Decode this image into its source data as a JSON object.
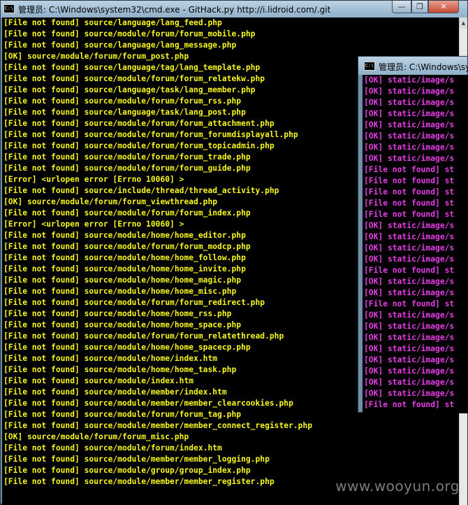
{
  "main_window": {
    "icon_label": "C:\\",
    "title": "管理员: C:\\Windows\\system32\\cmd.exe - GitHack.py  http://i.lidroid.com/.git",
    "controls": {
      "minimize": "—",
      "maximize": "❐",
      "close": "✕"
    },
    "lines": [
      "[File not found] source/language/lang_feed.php",
      "[File not found] source/module/forum/forum_mobile.php",
      "[File not found] source/language/lang_message.php",
      "[OK] source/module/forum/forum_post.php",
      "[File not found] source/language/tag/lang_template.php",
      "[File not found] source/module/forum/forum_relatekw.php",
      "[File not found] source/language/task/lang_member.php",
      "[File not found] source/module/forum/forum_rss.php",
      "[File not found] source/language/task/lang_post.php",
      "[File not found] source/module/forum/forum_attachment.php",
      "[File not found] source/module/forum/forum_forumdisplayall.php",
      "[File not found] source/module/forum/forum_topicadmin.php",
      "[File not found] source/module/forum/forum_trade.php",
      "[File not found] source/module/forum/forum_guide.php",
      "[Error] <urlopen error [Errno 10060] >",
      "[File not found] source/include/thread/thread_activity.php",
      "[OK] source/module/forum/forum_viewthread.php",
      "[File not found] source/module/forum/forum_index.php",
      "[Error] <urlopen error [Errno 10060] >",
      "[File not found] source/module/home/home_editor.php",
      "[File not found] source/module/forum/forum_modcp.php",
      "[File not found] source/module/home/home_follow.php",
      "[File not found] source/module/home/home_invite.php",
      "[File not found] source/module/home/home_magic.php",
      "[File not found] source/module/home/home_misc.php",
      "[File not found] source/module/forum/forum_redirect.php",
      "[File not found] source/module/home/home_rss.php",
      "[File not found] source/module/home/home_space.php",
      "[File not found] source/module/forum/forum_relatethread.php",
      "[File not found] source/module/home/home_spacecp.php",
      "[File not found] source/module/home/index.htm",
      "[File not found] source/module/home/home_task.php",
      "[File not found] source/module/index.htm",
      "[File not found] source/module/member/index.htm",
      "[File not found] source/module/member/member_clearcookies.php",
      "[File not found] source/module/forum/forum_tag.php",
      "[File not found] source/module/member/member_connect_register.php",
      "[OK] source/module/forum/forum_misc.php",
      "[File not found] source/module/forum/index.htm",
      "[File not found] source/module/member/member_logging.php",
      "[File not found] source/module/group/group_index.php",
      "[File not found] source/module/member/member_register.php"
    ]
  },
  "second_window": {
    "icon_label": "C:\\",
    "title": "管理员: C:\\Windows\\sys",
    "lines": [
      "[OK] static/image/s",
      "[OK] static/image/s",
      "[OK] static/image/s",
      "[OK] static/image/s",
      "[OK] static/image/s",
      "[OK] static/image/s",
      "[OK] static/image/s",
      "[OK] static/image/s",
      "[File not found] st",
      "[File not found] st",
      "[File not found] st",
      "[File not found] st",
      "[File not found] st",
      "[OK] static/image/s",
      "[OK] static/image/s",
      "[OK] static/image/s",
      "[OK] static/image/s",
      "[File not found] st",
      "[OK] static/image/s",
      "[OK] static/image/s",
      "[File not found] st",
      "[OK] static/image/s",
      "[OK] static/image/s",
      "[OK] static/image/s",
      "[OK] static/image/s",
      "[OK] static/image/s",
      "[OK] static/image/s",
      "[OK] static/image/s",
      "[OK] static/image/s",
      "[File not found] st"
    ]
  },
  "scrollbar": {
    "up_arrow": "▲",
    "down_arrow": "▼"
  },
  "watermark": "www.wooyun.org",
  "colors": {
    "main_text": "#f6f620",
    "second_text": "#e63ee6",
    "console_bg": "#000000"
  }
}
